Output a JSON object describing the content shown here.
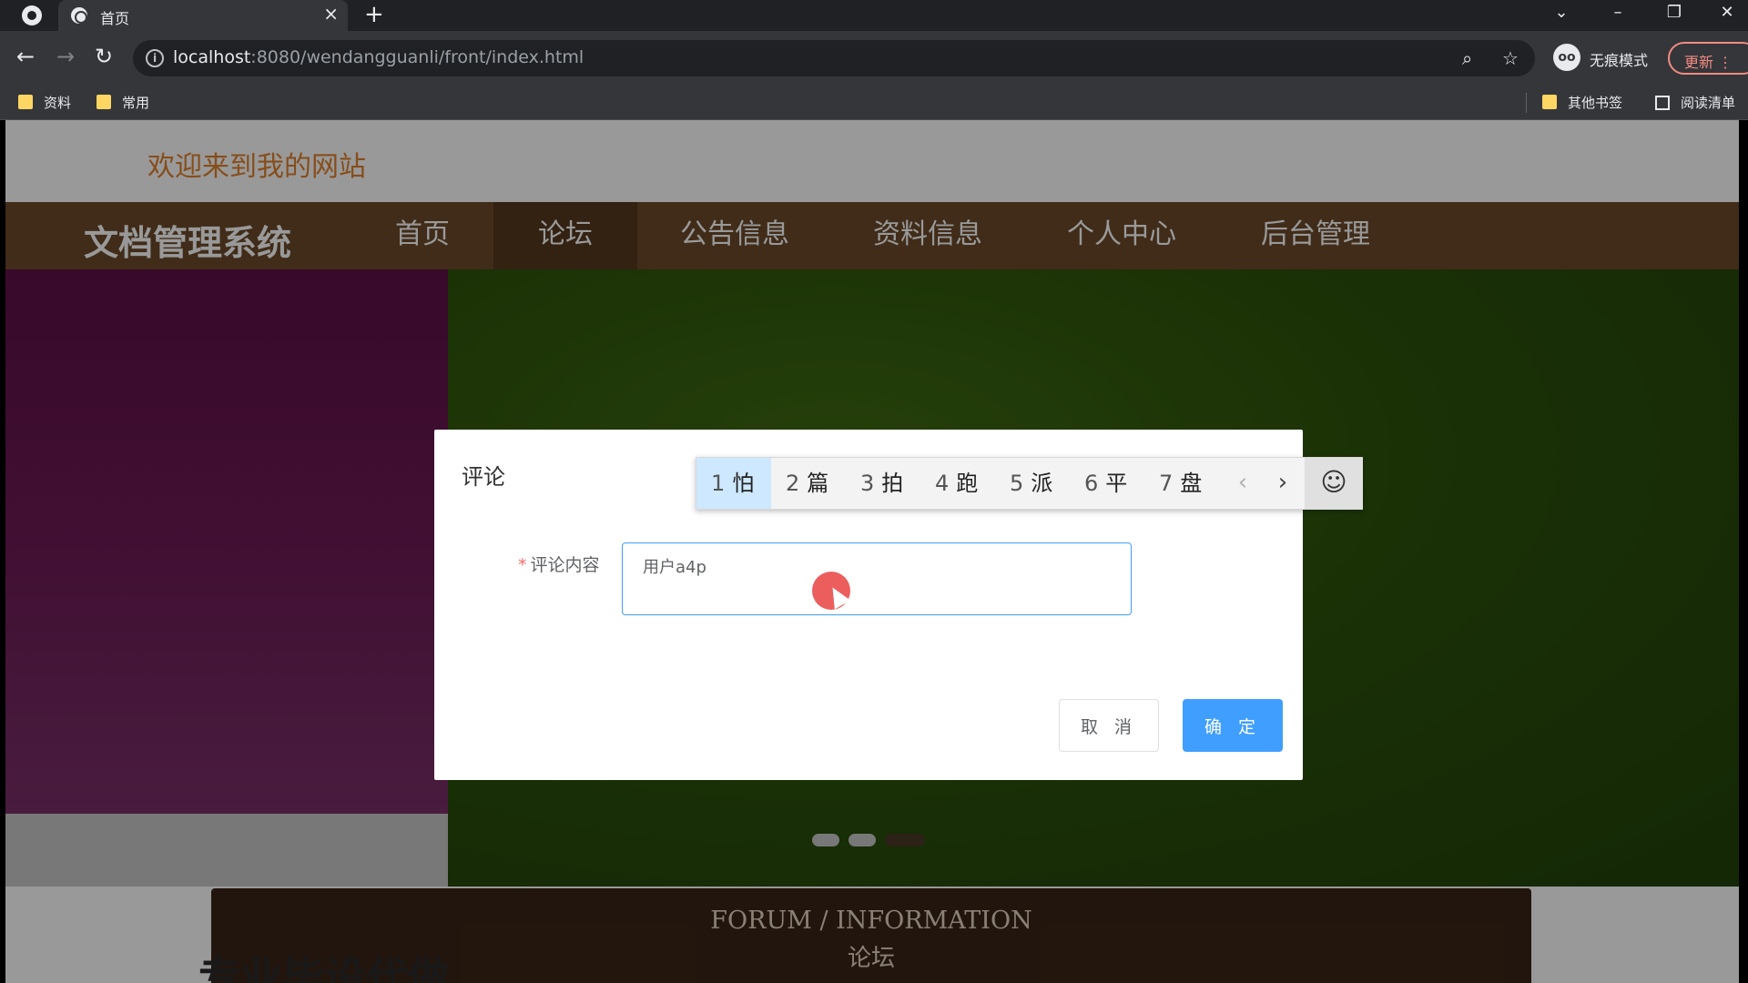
{
  "browser": {
    "tab_title": "首页",
    "url_host": "localhost",
    "url_rest": ":8080/wendangguanli/front/index.html",
    "incognito_label": "无痕模式",
    "update_label": "更新",
    "bookmarks": [
      "资料",
      "常用"
    ],
    "other_bookmarks": "其他书签",
    "reading_list": "阅读清单"
  },
  "site": {
    "welcome": "欢迎来到我的网站",
    "brand": "文档管理系统",
    "nav": [
      {
        "label": "首页"
      },
      {
        "label": "论坛",
        "active": true
      },
      {
        "label": "公告信息"
      },
      {
        "label": "资料信息"
      },
      {
        "label": "个人中心"
      },
      {
        "label": "后台管理"
      }
    ],
    "section_en": "FORUM / INFORMATION",
    "section_cn": "论坛",
    "bottom_text": "专业毕设代做"
  },
  "dialog": {
    "title": "评论",
    "field_label": "评论内容",
    "input_value": "用户a4p",
    "cancel_label": "取 消",
    "ok_label": "确 定"
  },
  "ime": {
    "candidates": [
      {
        "num": "1",
        "text": "怕"
      },
      {
        "num": "2",
        "text": "篇"
      },
      {
        "num": "3",
        "text": "拍"
      },
      {
        "num": "4",
        "text": "跑"
      },
      {
        "num": "5",
        "text": "派"
      },
      {
        "num": "6",
        "text": "平"
      },
      {
        "num": "7",
        "text": "盘"
      }
    ],
    "prev": "‹",
    "next": "›",
    "emoji": "☺"
  },
  "colors": {
    "welcome": "#e0822e",
    "navbar": "#6b4a2a",
    "primary": "#409eff"
  }
}
